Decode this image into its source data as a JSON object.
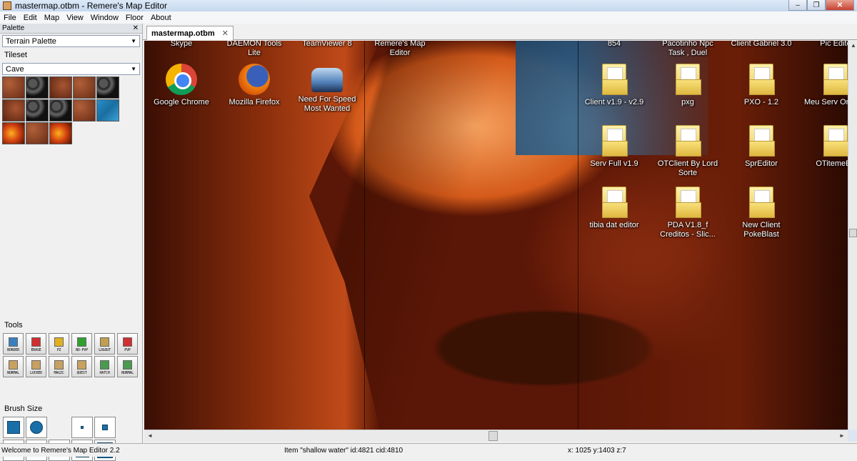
{
  "window": {
    "title": "mastermap.otbm - Remere's Map Editor",
    "controls": [
      "–",
      "❐",
      "✕"
    ]
  },
  "menubar": [
    "File",
    "Edit",
    "Map",
    "View",
    "Window",
    "Floor",
    "About"
  ],
  "palette": {
    "header": "Palette",
    "close": "✕",
    "palette_select": "Terrain Palette",
    "tileset_label": "Tileset",
    "tileset_select": "Cave",
    "tiles": [
      "rock",
      "dark",
      "rock2",
      "rock",
      "dark",
      "rock2",
      "dark",
      "dark",
      "rock",
      "water",
      "lava",
      "rock",
      "lava"
    ]
  },
  "tools": {
    "label": "Tools",
    "items": [
      {
        "label": "BORDER",
        "color": "#3a80c0"
      },
      {
        "label": "ERASE",
        "color": "#d03030"
      },
      {
        "label": "PZ",
        "color": "#e0b020"
      },
      {
        "label": "NO-PVP",
        "color": "#30a030"
      },
      {
        "label": "LOGOUT",
        "color": "#c0a050"
      },
      {
        "label": "PVP",
        "color": "#d03030"
      },
      {
        "label": "NORMAL",
        "color": "#c8a060"
      },
      {
        "label": "LOCKED",
        "color": "#c8a060"
      },
      {
        "label": "MAGIC",
        "color": "#c8a060"
      },
      {
        "label": "QUEST",
        "color": "#c8a060"
      },
      {
        "label": "HATCH",
        "color": "#4a9a50"
      },
      {
        "label": "NORMAL",
        "color": "#4a9a50"
      }
    ]
  },
  "brush": {
    "label": "Brush Size"
  },
  "tab": {
    "label": "mastermap.otbm",
    "close": "✕"
  },
  "desktop": {
    "top_labels": [
      "Skype",
      "DAEMON Tools Lite",
      "TeamViewer 8",
      "Remere's Map Editor",
      "854",
      "Pacotinho Npc Task , Duel",
      "Client Gabriel 3.0",
      "Pic Edito"
    ],
    "icons": [
      {
        "label": "Google Chrome",
        "icon": "chrome-icon"
      },
      {
        "label": "Mozilla Firefox",
        "icon": "firefox-icon"
      },
      {
        "label": "Need For Speed Most Wanted",
        "icon": "nfs-icon"
      },
      {
        "label": "Client v1.9 - v2.9",
        "icon": "folder-icon"
      },
      {
        "label": "pxg",
        "icon": "folder-icon"
      },
      {
        "label": "PXO - 1.2",
        "icon": "folder-icon"
      },
      {
        "label": "Meu Serv Original",
        "icon": "folder-icon"
      },
      {
        "label": "Serv Full v1.9",
        "icon": "folder-icon"
      },
      {
        "label": "OTClient By Lord Sorte",
        "icon": "folder-icon"
      },
      {
        "label": "SprEditor",
        "icon": "folder-icon"
      },
      {
        "label": "OTitemeEd",
        "icon": "folder-icon"
      },
      {
        "label": "tibia dat editor",
        "icon": "folder-icon"
      },
      {
        "label": "PDA V1.8_f Creditos - Slic...",
        "icon": "folder-icon"
      },
      {
        "label": "New Client PokeBlast",
        "icon": "folder-icon"
      }
    ]
  },
  "status": {
    "welcome": "Welcome to Remere's Map Editor 2.2",
    "item": "Item \"shallow water\" id:4821 cid:4810",
    "coords": "x: 1025 y:1403 z:7"
  }
}
